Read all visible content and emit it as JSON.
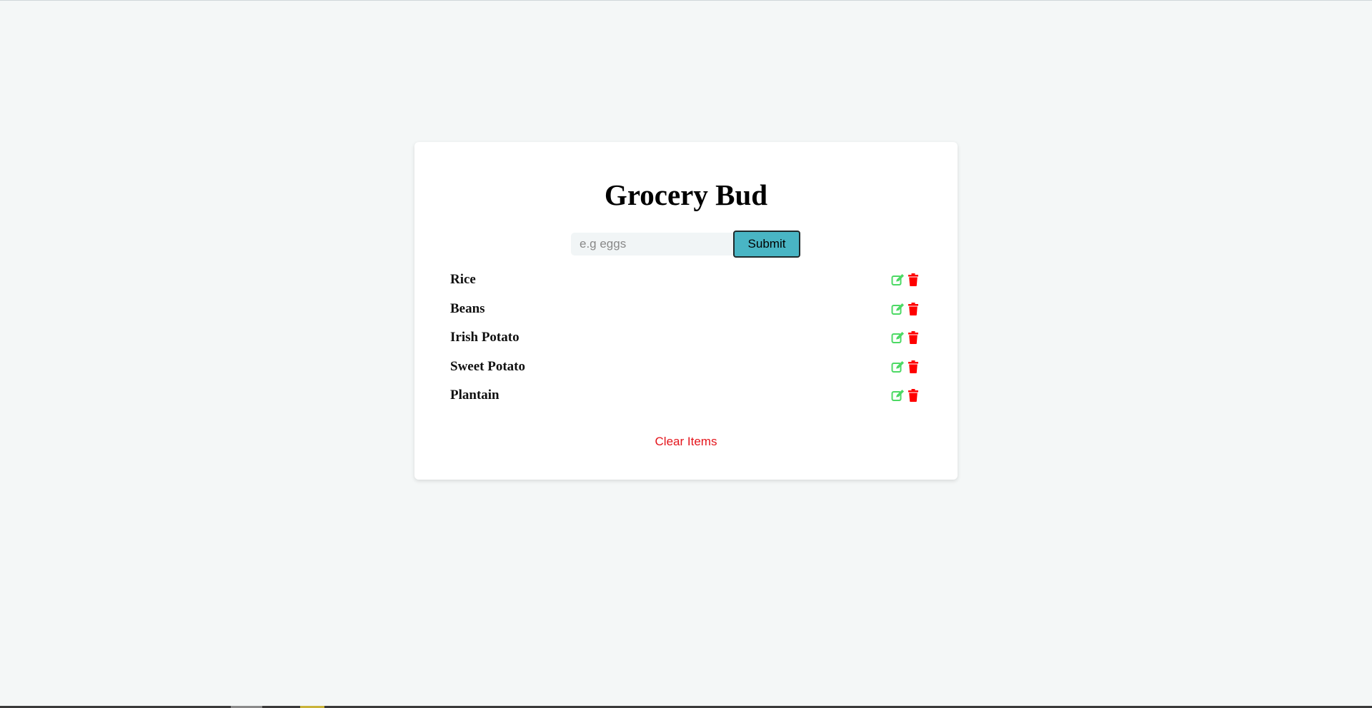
{
  "app": {
    "title": "Grocery Bud"
  },
  "form": {
    "placeholder": "e.g eggs",
    "value": "",
    "submit_label": "Submit"
  },
  "items": [
    {
      "name": "Rice"
    },
    {
      "name": "Beans"
    },
    {
      "name": "Irish Potato"
    },
    {
      "name": "Sweet Potato"
    },
    {
      "name": "Plantain"
    }
  ],
  "item_actions": {
    "edit_icon": "edit-icon",
    "delete_icon": "trash-icon"
  },
  "clear_label": "Clear Items",
  "colors": {
    "background": "#f4f7f7",
    "submit": "#49b5c4",
    "edit": "#4cd964",
    "delete": "#ff0000",
    "clear": "#e4141b"
  }
}
